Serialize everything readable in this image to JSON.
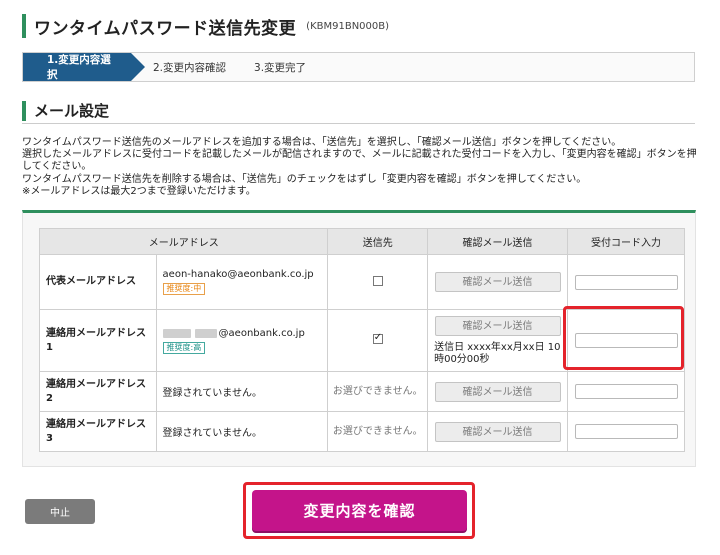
{
  "header": {
    "title": "ワンタイムパスワード送信先変更",
    "code": "(KBM91BN000B)"
  },
  "steps": [
    {
      "label": "1.変更内容選択"
    },
    {
      "label": "2.変更内容確認"
    },
    {
      "label": "3.変更完了"
    }
  ],
  "section": {
    "title": "メール設定"
  },
  "description": [
    "ワンタイムパスワード送信先のメールアドレスを追加する場合は、「送信先」を選択し、「確認メール送信」ボタンを押してください。",
    "選択したメールアドレスに受付コードを記載したメールが配信されますので、メールに記載された受付コードを入力し、「変更内容を確認」ボタンを押してください。",
    "ワンタイムパスワード送信先を削除する場合は、「送信先」のチェックをはずし「変更内容を確認」ボタンを押してください。",
    "※メールアドレスは最大2つまで登録いただけます。"
  ],
  "table": {
    "headers": [
      "メールアドレス",
      "送信先",
      "確認メール送信",
      "受付コード入力"
    ],
    "rows": [
      {
        "label": "代表メールアドレス",
        "address": "aeon-hanako@aeonbank.co.jp",
        "badge": "推奨度:中",
        "send": "unchecked",
        "confirm_btn": "確認メール送信"
      },
      {
        "label": "連絡用メールアドレス\n1",
        "address": "@aeonbank.co.jp",
        "badge": "推奨度:高",
        "send": "checked",
        "confirm_btn": "確認メール送信",
        "sent_info": "送信日 xxxx年xx月xx日 10時00分00秒"
      },
      {
        "label": "連絡用メールアドレス\n2",
        "address": "登録されていません。",
        "send_text": "お選びできません。",
        "confirm_btn": "確認メール送信"
      },
      {
        "label": "連絡用メールアドレス\n3",
        "address": "登録されていません。",
        "send_text": "お選びできません。",
        "confirm_btn": "確認メール送信"
      }
    ]
  },
  "buttons": {
    "cancel": "中止",
    "submit": "変更内容を確認"
  },
  "colors": {
    "accent_green": "#2e8f5d",
    "step_active": "#1f5c8c",
    "submit": "#c4148a",
    "highlight": "#e4232b"
  }
}
